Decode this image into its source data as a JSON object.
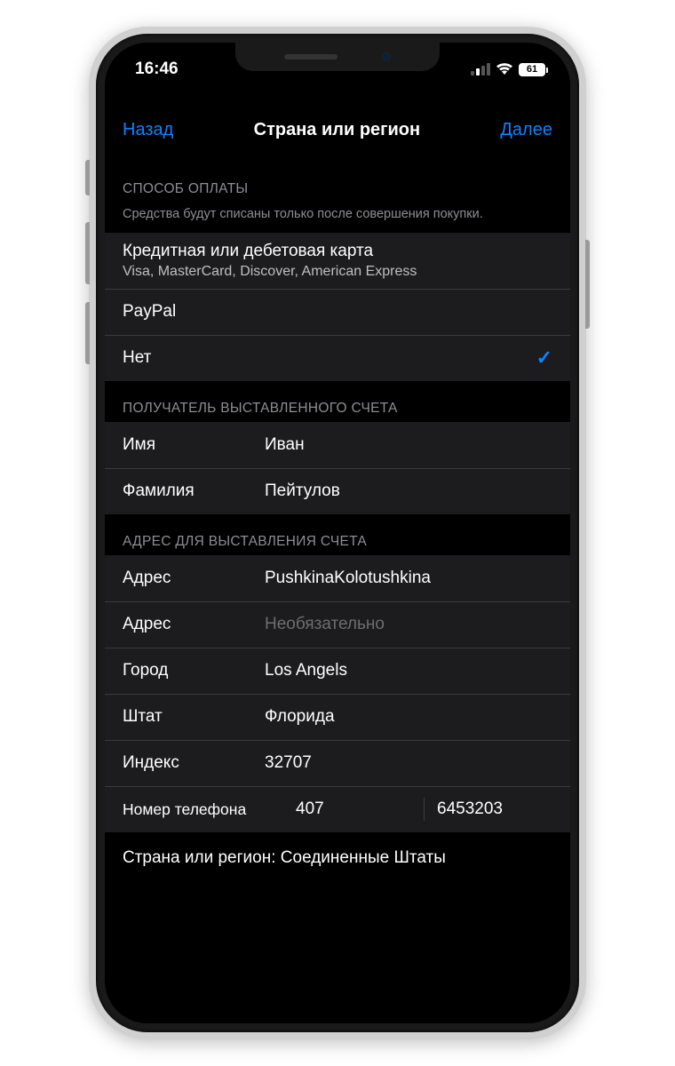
{
  "status": {
    "time": "16:46",
    "battery": "61"
  },
  "nav": {
    "back": "Назад",
    "title": "Страна или регион",
    "next": "Далее"
  },
  "payment": {
    "header": "СПОСОБ ОПЛАТЫ",
    "footer": "Средства будут списаны только после совершения покупки.",
    "credit_title": "Кредитная или дебетовая карта",
    "credit_sub": "Visa, MasterCard, Discover, American Express",
    "paypal": "PayPal",
    "none": "Нет"
  },
  "recipient": {
    "header": "ПОЛУЧАТЕЛЬ ВЫСТАВЛЕННОГО СЧЕТА",
    "firstname_label": "Имя",
    "firstname_value": "Иван",
    "lastname_label": "Фамилия",
    "lastname_value": "Пейтулов"
  },
  "billing": {
    "header": "АДРЕС ДЛЯ ВЫСТАВЛЕНИЯ СЧЕТА",
    "address1_label": "Адрес",
    "address1_value": "PushkinaKolotushkina",
    "address2_label": "Адрес",
    "address2_placeholder": "Необязательно",
    "city_label": "Город",
    "city_value": "Los Angels",
    "state_label": "Штат",
    "state_value": "Флорида",
    "zip_label": "Индекс",
    "zip_value": "32707",
    "phone_label": "Номер телефона",
    "phone_area": "407",
    "phone_number": "6453203"
  },
  "bottom": {
    "country_line": "Страна или регион: Соединенные Штаты"
  }
}
